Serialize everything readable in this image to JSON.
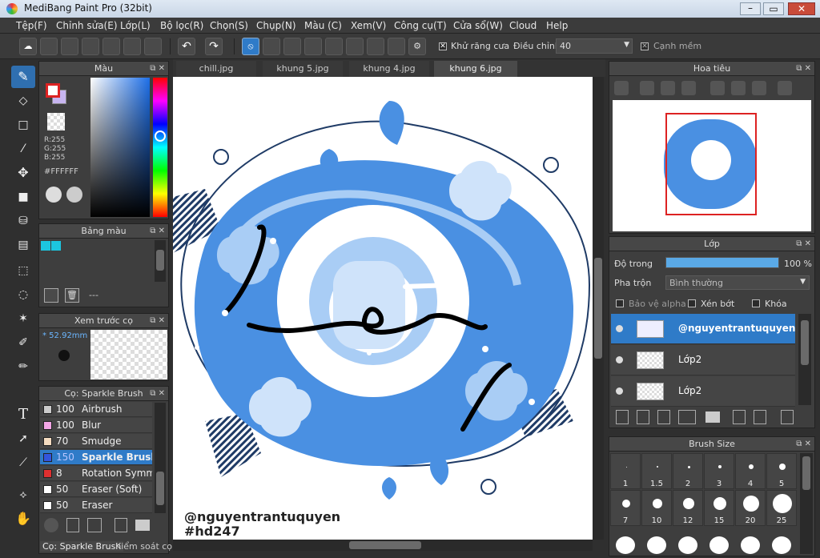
{
  "window": {
    "title": "MediBang Paint Pro (32bit)"
  },
  "menu": [
    "Tệp(F)",
    "Chỉnh sửa(E)",
    "Lớp(L)",
    "Bộ lọc(R)",
    "Chọn(S)",
    "Chụp(N)",
    "Màu (C)",
    "Xem(V)",
    "Công cụ(T)",
    "Cửa sổ(W)",
    "Cloud",
    "Help"
  ],
  "toolbar": {
    "antialias_label": "Khử răng cưa",
    "adjust_label": "Điều chỉnh",
    "adjust_value": "40",
    "smooth_label": "Cạnh mềm"
  },
  "color_panel": {
    "title": "Màu",
    "r": "R:255",
    "g": "G:255",
    "b": "B:255",
    "hex": "#FFFFFF"
  },
  "palette_panel": {
    "title": "Bảng màu",
    "name": "---"
  },
  "brush_preview": {
    "title": "Xem trước cọ",
    "size": "* 52.92mm"
  },
  "brush_panel": {
    "title": "Cọ: Sparkle Brush",
    "items": [
      {
        "size": "100",
        "name": "Airbrush",
        "color": "#cccccc"
      },
      {
        "size": "100",
        "name": "Blur",
        "color": "#f3a6e6"
      },
      {
        "size": "70",
        "name": "Smudge",
        "color": "#f5dcc0"
      },
      {
        "size": "150",
        "name": "Sparkle Brush",
        "color": "#3355dd"
      },
      {
        "size": "8",
        "name": "Rotation Symmetry Pen",
        "color": "#e03030"
      },
      {
        "size": "50",
        "name": "Eraser (Soft)",
        "color": "#ffffff"
      },
      {
        "size": "50",
        "name": "Eraser",
        "color": "#ffffff"
      }
    ],
    "tab1": "Cọ: Sparkle Brush",
    "tab2": "Kiểm soát cọ"
  },
  "tabs": [
    "chill.jpg",
    "khung 5.jpg",
    "khung 4.jpg",
    "khung 6.jpg"
  ],
  "canvas": {
    "watermark1": "@nguyentrantuquyen",
    "watermark2": "#hd247"
  },
  "navigator": {
    "title": "Hoa tiêu"
  },
  "layer_panel": {
    "title": "Lớp",
    "opacity_label": "Độ trong",
    "opacity_value": "100 %",
    "opacity": 1.0,
    "blend_label": "Pha trộn",
    "blend_value": "Bình thường",
    "protect_alpha": "Bảo vệ alpha",
    "clip": "Xén bớt",
    "lock": "Khóa",
    "layers": [
      {
        "name": "@nguyentrantuquyen"
      },
      {
        "name": "Lớp2"
      },
      {
        "name": "Lớp2"
      }
    ]
  },
  "brush_size": {
    "title": "Brush Size",
    "sizes": [
      "1",
      "1.5",
      "2",
      "3",
      "4",
      "5",
      "7",
      "10",
      "12",
      "15",
      "20",
      "25"
    ]
  },
  "colors": {
    "accent": "#2f7bc8",
    "canvas_blue": "#4a90e2",
    "light_blue": "#a9cdf5"
  }
}
